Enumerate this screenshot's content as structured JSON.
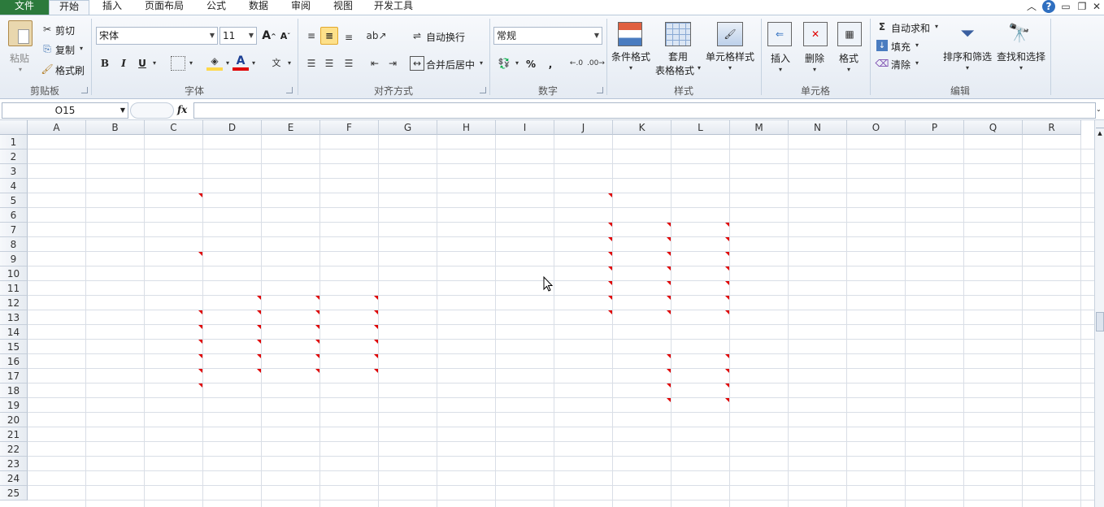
{
  "tabs": [
    "文件",
    "开始",
    "插入",
    "页面布局",
    "公式",
    "数据",
    "审阅",
    "视图",
    "开发工具"
  ],
  "clipboard": {
    "paste": "粘贴",
    "cut": "剪切",
    "copy": "复制",
    "painter": "格式刷",
    "label": "剪贴板"
  },
  "font": {
    "name": "宋体",
    "size": "11",
    "bold": "B",
    "italic": "I",
    "underline": "U",
    "label": "字体",
    "grow": "A",
    "shrink": "A"
  },
  "align": {
    "wrap": "自动换行",
    "merge": "合并后居中",
    "label": "对齐方式"
  },
  "number": {
    "format": "常规",
    "percent": "%",
    "comma": ",",
    "label": "数字"
  },
  "styles": {
    "cond": "条件格式",
    "table1": "套用",
    "table2": "表格格式",
    "cell": "单元格样式",
    "label": "样式"
  },
  "cells": {
    "insert": "插入",
    "delete": "删除",
    "format": "格式",
    "label": "单元格"
  },
  "edit": {
    "autosum": "自动求和",
    "fill": "填充",
    "clear": "清除",
    "sort": "排序和筛选",
    "find": "查找和选择",
    "label": "编辑",
    "sigma": "Σ"
  },
  "namebox": "O15",
  "fx": "fx",
  "columns": [
    "A",
    "B",
    "C",
    "D",
    "E",
    "F",
    "G",
    "H",
    "I",
    "J",
    "K",
    "L",
    "M",
    "N",
    "O",
    "P",
    "Q",
    "R"
  ],
  "rows": [
    "1",
    "2",
    "3",
    "4",
    "5",
    "6",
    "7",
    "8",
    "9",
    "10",
    "11",
    "12",
    "13",
    "14",
    "15",
    "16",
    "17",
    "18",
    "19",
    "20",
    "21",
    "22",
    "23",
    "24",
    "25"
  ],
  "comments": [
    {
      "col": "C",
      "row": 5
    },
    {
      "col": "C",
      "row": 9
    },
    {
      "col": "C",
      "row": 13
    },
    {
      "col": "C",
      "row": 14
    },
    {
      "col": "C",
      "row": 15
    },
    {
      "col": "C",
      "row": 16
    },
    {
      "col": "C",
      "row": 17
    },
    {
      "col": "C",
      "row": 18
    },
    {
      "col": "D",
      "row": 12
    },
    {
      "col": "D",
      "row": 13
    },
    {
      "col": "D",
      "row": 14
    },
    {
      "col": "D",
      "row": 15
    },
    {
      "col": "D",
      "row": 16
    },
    {
      "col": "D",
      "row": 17
    },
    {
      "col": "E",
      "row": 12
    },
    {
      "col": "E",
      "row": 13
    },
    {
      "col": "E",
      "row": 14
    },
    {
      "col": "E",
      "row": 15
    },
    {
      "col": "E",
      "row": 16
    },
    {
      "col": "E",
      "row": 17
    },
    {
      "col": "F",
      "row": 12
    },
    {
      "col": "F",
      "row": 13
    },
    {
      "col": "F",
      "row": 14
    },
    {
      "col": "F",
      "row": 15
    },
    {
      "col": "F",
      "row": 16
    },
    {
      "col": "F",
      "row": 17
    },
    {
      "col": "J",
      "row": 5
    },
    {
      "col": "J",
      "row": 7
    },
    {
      "col": "J",
      "row": 8
    },
    {
      "col": "J",
      "row": 9
    },
    {
      "col": "J",
      "row": 10
    },
    {
      "col": "J",
      "row": 11
    },
    {
      "col": "J",
      "row": 12
    },
    {
      "col": "J",
      "row": 13
    },
    {
      "col": "K",
      "row": 7
    },
    {
      "col": "K",
      "row": 8
    },
    {
      "col": "K",
      "row": 9
    },
    {
      "col": "K",
      "row": 10
    },
    {
      "col": "K",
      "row": 11
    },
    {
      "col": "K",
      "row": 12
    },
    {
      "col": "K",
      "row": 13
    },
    {
      "col": "K",
      "row": 16
    },
    {
      "col": "K",
      "row": 17
    },
    {
      "col": "K",
      "row": 18
    },
    {
      "col": "K",
      "row": 19
    },
    {
      "col": "L",
      "row": 7
    },
    {
      "col": "L",
      "row": 8
    },
    {
      "col": "L",
      "row": 9
    },
    {
      "col": "L",
      "row": 10
    },
    {
      "col": "L",
      "row": 11
    },
    {
      "col": "L",
      "row": 12
    },
    {
      "col": "L",
      "row": 13
    },
    {
      "col": "L",
      "row": 16
    },
    {
      "col": "L",
      "row": 17
    },
    {
      "col": "L",
      "row": 18
    },
    {
      "col": "L",
      "row": 19
    }
  ]
}
